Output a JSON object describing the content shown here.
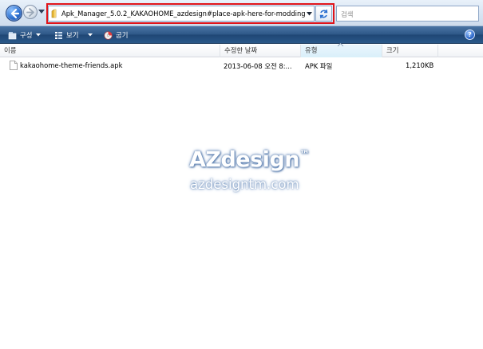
{
  "address_bar": {
    "path": "Apk_Manager_5.0.2_KAKAOHOME_azdesign#place-apk-here-for-modding"
  },
  "search": {
    "placeholder": "검색"
  },
  "command_bar": {
    "organize_label": "구성",
    "view_label": "보기",
    "burn_label": "굽기",
    "help_label": "?"
  },
  "columns": [
    {
      "label": "이름"
    },
    {
      "label": "수정한 날짜"
    },
    {
      "label": "유형"
    },
    {
      "label": "크기"
    }
  ],
  "files": [
    {
      "name": "kakaohome-theme-friends.apk",
      "date": "2013-06-08 오전 8:...",
      "type": "APK 파일",
      "size": "1,210KB",
      "icon": "document-icon"
    }
  ],
  "watermark": {
    "title": "AZdesign",
    "tm": "™",
    "subtitle": "azdesigntm.com"
  },
  "colors": {
    "highlight": "#e0141a",
    "command_bar": "#2d5787"
  }
}
